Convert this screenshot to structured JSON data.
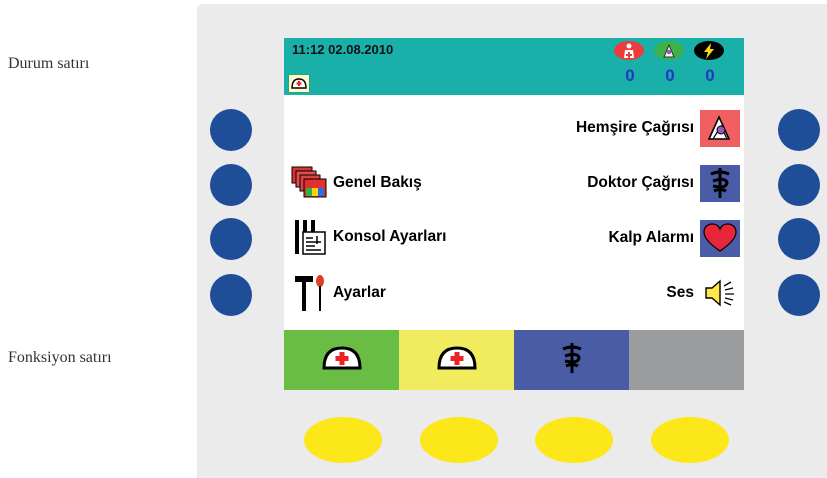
{
  "labels": {
    "status_row": "Durum satırı",
    "function_row": "Fonksiyon satırı"
  },
  "status_bar": {
    "datetime": "11:12 02.08.2010",
    "counters": [
      {
        "icon": "nurse-person-icon",
        "color": "#ee3b3b",
        "count": "0"
      },
      {
        "icon": "nurse-call-icon",
        "color": "#3cb24a",
        "count": "0"
      },
      {
        "icon": "lightning-icon",
        "color": "#000000",
        "count": "0"
      }
    ]
  },
  "menu_left": [
    {
      "label": "",
      "icon": ""
    },
    {
      "label": "Genel Bakış",
      "icon": "overview-icon"
    },
    {
      "label": "Konsol Ayarları",
      "icon": "console-settings-icon"
    },
    {
      "label": "Ayarlar",
      "icon": "tools-icon"
    }
  ],
  "menu_right": [
    {
      "label": "Hemşire Çağrısı",
      "icon": "nurse-call-icon"
    },
    {
      "label": "Doktor Çağrısı",
      "icon": "caduceus-icon"
    },
    {
      "label": "Kalp Alarmı",
      "icon": "heart-icon"
    },
    {
      "label": "Ses",
      "icon": "speaker-icon"
    }
  ],
  "function_keys": [
    {
      "icon": "nurse-cap-icon",
      "color": "#69bd45"
    },
    {
      "icon": "nurse-cap-icon",
      "color": "#f1ec5e"
    },
    {
      "icon": "caduceus-icon",
      "color": "#4a5ca6"
    },
    {
      "icon": "",
      "color": "#9b9c9e"
    }
  ],
  "colors": {
    "screen_header": "#19b0a9",
    "hardware_button": "#1f4e99",
    "softkey": "#fce81a",
    "panel": "#ebebeb"
  }
}
